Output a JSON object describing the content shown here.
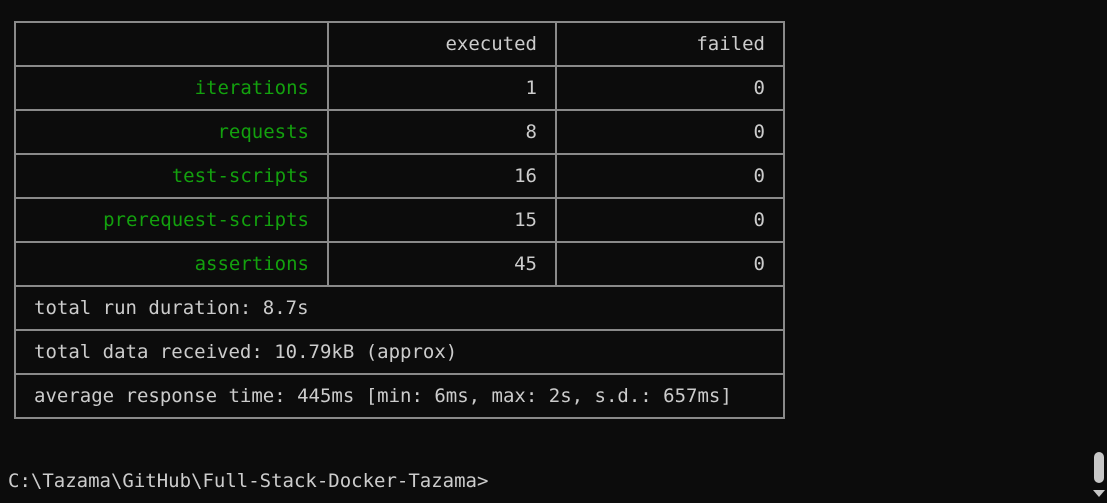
{
  "table": {
    "headers": [
      "",
      "executed",
      "failed"
    ],
    "rows": [
      {
        "label": "iterations",
        "executed": "1",
        "failed": "0"
      },
      {
        "label": "requests",
        "executed": "8",
        "failed": "0"
      },
      {
        "label": "test-scripts",
        "executed": "16",
        "failed": "0"
      },
      {
        "label": "prerequest-scripts",
        "executed": "15",
        "failed": "0"
      },
      {
        "label": "assertions",
        "executed": "45",
        "failed": "0"
      }
    ],
    "footer": [
      "total run duration: 8.7s",
      "total data received: 10.79kB (approx)",
      "average response time: 445ms [min: 6ms, max: 2s, s.d.: 657ms]"
    ]
  },
  "prompt": "C:\\Tazama\\GitHub\\Full-Stack-Docker-Tazama>",
  "colors": {
    "background": "#0c0c0c",
    "text": "#cccccc",
    "label_green": "#13a10e",
    "border": "#8a8a8a"
  }
}
